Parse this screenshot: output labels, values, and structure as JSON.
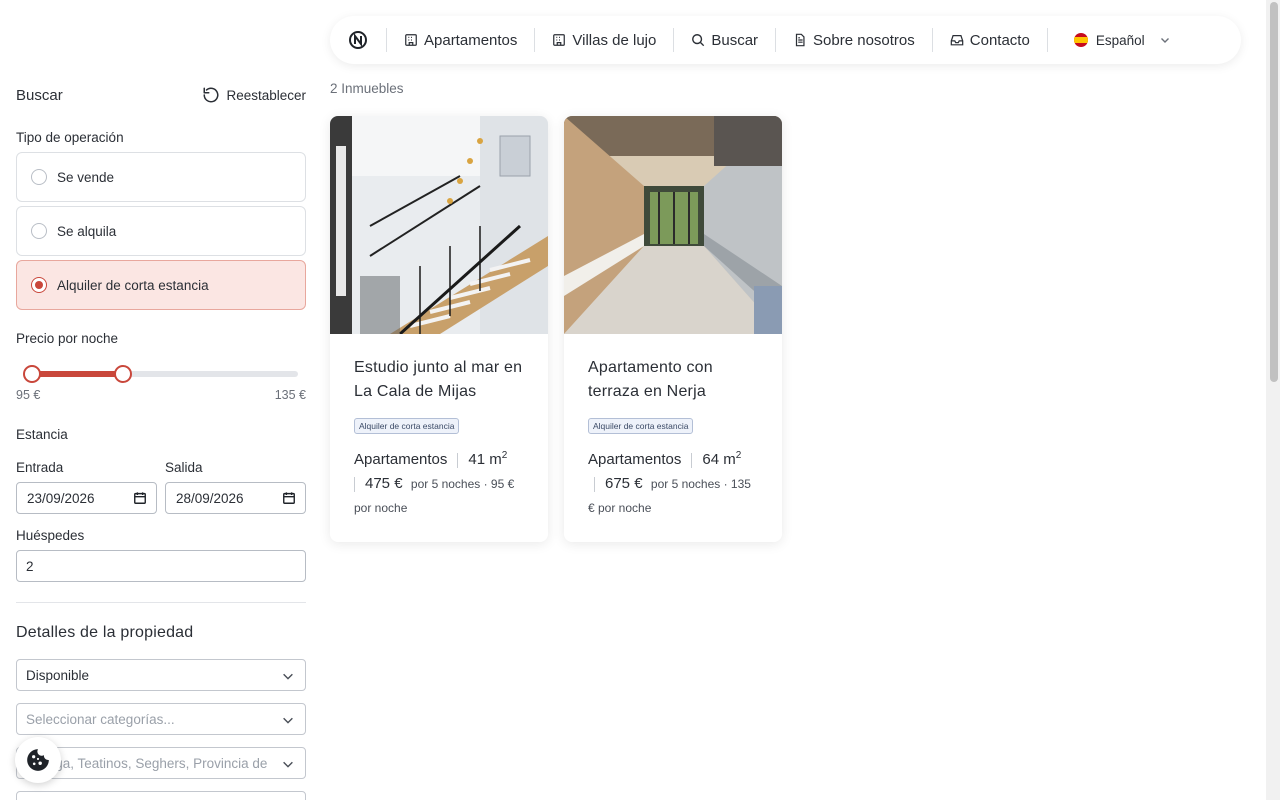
{
  "nav": {
    "items": [
      {
        "label": "Apartamentos",
        "icon": "building-icon"
      },
      {
        "label": "Villas de lujo",
        "icon": "building-icon"
      },
      {
        "label": "Buscar",
        "icon": "search-icon"
      },
      {
        "label": "Sobre nosotros",
        "icon": "document-icon"
      },
      {
        "label": "Contacto",
        "icon": "inbox-icon"
      }
    ],
    "language": "Español"
  },
  "results": {
    "count": "2 Inmuebles"
  },
  "filters": {
    "title": "Buscar",
    "reset_label": "Reestablecer",
    "operation": {
      "label": "Tipo de operación",
      "options": [
        "Se vende",
        "Se alquila",
        "Alquiler de corta estancia"
      ],
      "selected": "Alquiler de corta estancia"
    },
    "price": {
      "label": "Precio por noche",
      "min_label": "95 €",
      "max_label": "135 €",
      "low_fraction": 0,
      "high_fraction": 0.36
    },
    "stay": {
      "label": "Estancia",
      "checkin_label": "Entrada",
      "checkin_value": "23/09/2026",
      "checkout_label": "Salida",
      "checkout_value": "28/09/2026"
    },
    "guests": {
      "label": "Huéspedes",
      "value": "2"
    },
    "details": {
      "title": "Detalles de la propiedad",
      "availability": "Disponible",
      "categories_placeholder": "Seleccionar categorías...",
      "location_placeholder": "Málaga, Teatinos, Seghers, Provincia de"
    }
  },
  "listings": [
    {
      "title": "Estudio junto al mar en La Cala de Mijas",
      "badge": "Alquiler de corta estancia",
      "type": "Apartamentos",
      "area": "41 m",
      "area_sup": "2",
      "price": "475 €",
      "price_note": "por 5 noches · 95 € por noche"
    },
    {
      "title": "Apartamento con terraza en Nerja",
      "badge": "Alquiler de corta estancia",
      "type": "Apartamentos",
      "area": "64 m",
      "area_sup": "2",
      "price": "675 €",
      "price_note": "por 5 noches · 135 € por noche"
    }
  ],
  "colors": {
    "accent": "#c9473b",
    "accent_bg": "#fbe6e3"
  }
}
